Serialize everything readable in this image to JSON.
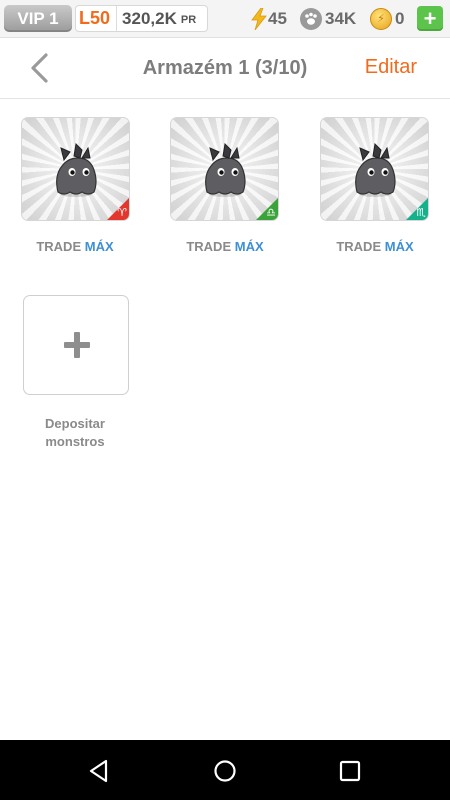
{
  "status": {
    "vip": "VIP 1",
    "level": "L50",
    "power": "320,2K",
    "power_unit": "PR",
    "energy": "45",
    "food": "34K",
    "gold": "0",
    "add": "+"
  },
  "header": {
    "title": "Armazém 1 (3/10)",
    "edit": "Editar"
  },
  "monsters": [
    {
      "trade": "TRADE",
      "max": "MÁX",
      "sign": "♈",
      "sign_color": "#e3362d"
    },
    {
      "trade": "TRADE",
      "max": "MÁX",
      "sign": "♎",
      "sign_color": "#3aa33a"
    },
    {
      "trade": "TRADE",
      "max": "MÁX",
      "sign": "♏",
      "sign_color": "#15b18b"
    }
  ],
  "deposit": {
    "line1": "Depositar",
    "line2": "monstros"
  },
  "colors": {
    "accent": "#f26a1b",
    "max_blue": "#3d8fd6"
  }
}
